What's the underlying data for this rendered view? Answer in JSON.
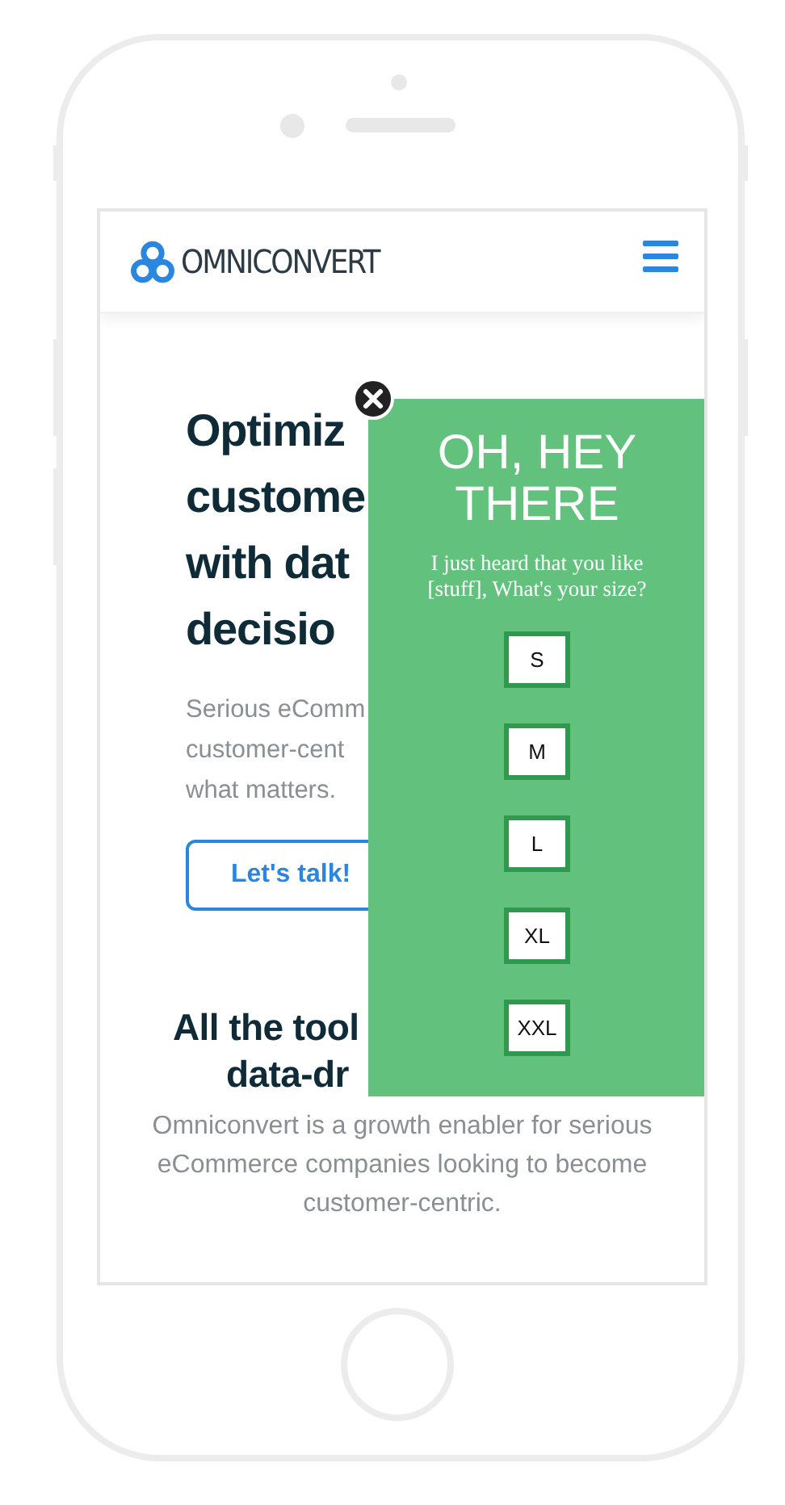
{
  "site": {
    "logo": "OMNICONVERT"
  },
  "hero": {
    "headline_lines": [
      "Optimiz",
      "custome",
      "with dat",
      "decisio"
    ],
    "text_lines": [
      "Serious eComm",
      "customer-cent",
      "what matters."
    ],
    "cta": "Let's talk!"
  },
  "tools": {
    "heading_lines": [
      "All the tool",
      "data-dr"
    ],
    "text": "Omniconvert is a growth enabler for serious eCommerce companies looking to become customer-centric."
  },
  "popup": {
    "title": "OH, HEY THERE",
    "message": "I just heard that you like [stuff], What's your size?",
    "sizes": [
      "S",
      "M",
      "L",
      "XL",
      "XXL"
    ]
  }
}
